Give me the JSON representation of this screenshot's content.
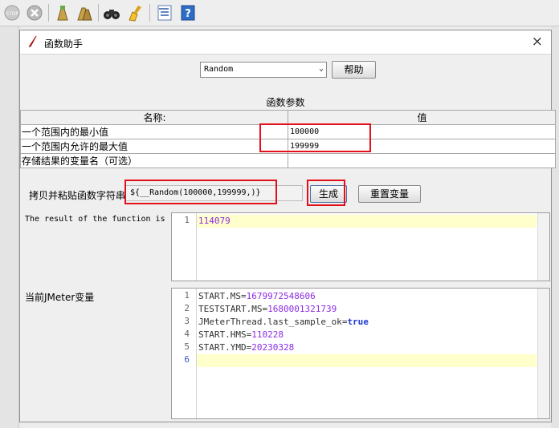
{
  "toolbar": {
    "icons": [
      "stop-icon",
      "shutdown-icon",
      "clear-icon",
      "clear-all-icon",
      "search-binoculars-icon",
      "reset-search-broom-icon",
      "function-helper-icon",
      "help-icon"
    ]
  },
  "dialog": {
    "title": "函数助手",
    "close": "×",
    "function_select": "Random",
    "help_button": "帮助",
    "params_title": "函数参数",
    "table": {
      "headers": [
        "名称:",
        "值"
      ],
      "rows": [
        {
          "name": "一个范围内的最小值",
          "value": "100000"
        },
        {
          "name": "一个范围内允许的最大值",
          "value": "199999"
        },
        {
          "name": "存储结果的变量名（可选）",
          "value": ""
        }
      ]
    },
    "copy_label": "拷贝并粘贴函数字符串",
    "function_string": "${__Random(100000,199999,)}",
    "generate_button": "生成",
    "reset_button": "重置变量",
    "result_label": "The result of the function is",
    "result_lines": [
      "114079"
    ],
    "vars_label": "当前JMeter变量",
    "vars_lines": [
      {
        "key": "START.MS",
        "value": "1679972548606"
      },
      {
        "key": "TESTSTART.MS",
        "value": "1680001321739"
      },
      {
        "key": "JMeterThread.last_sample_ok",
        "value": "true"
      },
      {
        "key": "START.HMS",
        "value": "110228"
      },
      {
        "key": "START.YMD",
        "value": "20230328"
      },
      {
        "key": "",
        "value": ""
      }
    ],
    "line_numbers": [
      "1",
      "2",
      "3",
      "4",
      "5",
      "6"
    ]
  },
  "colors": {
    "highlight_box": "#e2101a",
    "number": "#8a2be2",
    "keyword": "#1f39d6",
    "current_line": "#ffffcc"
  }
}
